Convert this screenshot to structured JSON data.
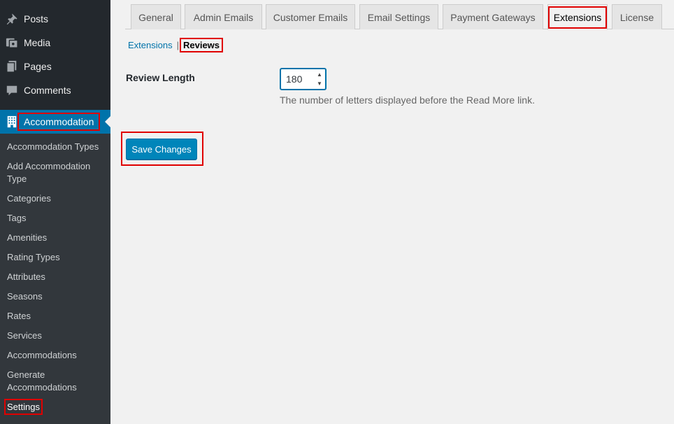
{
  "sidebar": {
    "top_items": [
      {
        "label": "Posts",
        "icon": "pin-icon"
      },
      {
        "label": "Media",
        "icon": "media-icon"
      },
      {
        "label": "Pages",
        "icon": "pages-icon"
      },
      {
        "label": "Comments",
        "icon": "comments-icon"
      }
    ],
    "active_menu": {
      "label": "Accommodation",
      "icon": "building-icon"
    },
    "submenu": [
      "Accommodation Types",
      "Add Accommodation Type",
      "Categories",
      "Tags",
      "Amenities",
      "Rating Types",
      "Attributes",
      "Seasons",
      "Rates",
      "Services",
      "Accommodations",
      "Generate Accommodations",
      "Settings"
    ],
    "current_submenu": "Settings"
  },
  "tabs": [
    "General",
    "Admin Emails",
    "Customer Emails",
    "Email Settings",
    "Payment Gateways",
    "Extensions",
    "License"
  ],
  "active_tab": "Extensions",
  "subnav": {
    "link": "Extensions",
    "separator": "|",
    "current": "Reviews"
  },
  "form": {
    "field_label": "Review Length",
    "field_value": "180",
    "field_description": "The number of letters displayed before the Read More link.",
    "save_label": "Save Changes"
  },
  "colors": {
    "accent": "#0073aa",
    "highlight": "#e00000",
    "sidebar": "#23282d"
  }
}
